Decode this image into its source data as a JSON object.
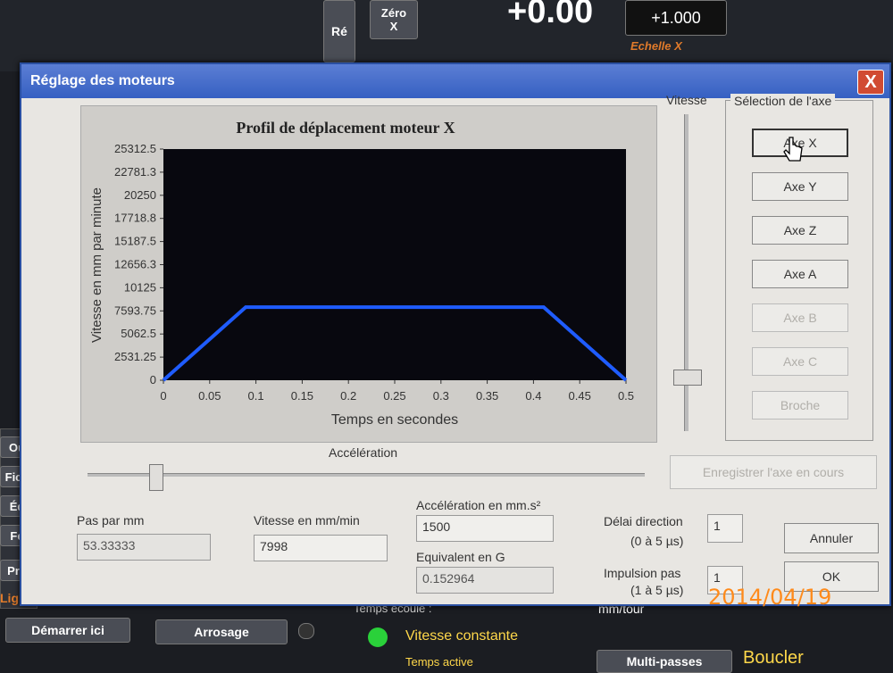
{
  "background": {
    "top_reset_label": "Ré",
    "zero_x_label": "Zéro\nX",
    "dro_value": "+0.00",
    "scale_value": "+1.000",
    "scale_label": "Echelle X",
    "left_menu": [
      "Ou",
      "Fich",
      "Éd",
      "Fe",
      "Pro"
    ],
    "ligne_label": "Ligne",
    "start_here_button": "Démarrer ici",
    "arrosage_button": "Arrosage",
    "vitesse_constante_label": "Vitesse constante",
    "multipasses_button": "Multi-passes",
    "boucler_button": "Boucler",
    "temps_ecoule_label": "Temps écoulé :",
    "mm_tour_label": "mm/tour",
    "temps_active_label": "Temps active"
  },
  "dialog": {
    "title": "Réglage des moteurs",
    "close_label": "X",
    "vitesse_label": "Vitesse",
    "axis_group_title": "Sélection de l'axe",
    "axis_buttons": [
      "Axe X",
      "Axe Y",
      "Axe Z",
      "Axe A",
      "Axe B",
      "Axe C",
      "Broche"
    ],
    "save_axis_button": "Enregistrer l'axe en cours",
    "acceleration_label": "Accélération",
    "pas_par_mm_label": "Pas par mm",
    "pas_par_mm_value": "53.33333",
    "vitesse_mm_min_label": "Vitesse en mm/min",
    "vitesse_mm_min_value": "7998",
    "accel_mm_s2_label": "Accélération en mm.s²",
    "accel_mm_s2_value": "1500",
    "equiv_g_label": "Equivalent en G",
    "equiv_g_value": "0.152964",
    "delai_direction_label": "Délai direction",
    "delai_direction_range": "(0 à 5 µs)",
    "delai_direction_value": "1",
    "impulsion_pas_label": "Impulsion pas",
    "impulsion_pas_range": "(1 à 5 µs)",
    "impulsion_pas_value": "1",
    "cancel_button": "Annuler",
    "ok_button": "OK"
  },
  "photo_date_stamp": "2014/04/19",
  "chart_data": {
    "type": "line",
    "title": "Profil de déplacement moteur X",
    "xlabel": "Temps en secondes",
    "ylabel": "Vitesse en mm par minute",
    "x_ticks": [
      "0",
      "0.05",
      "0.1",
      "0.15",
      "0.2",
      "0.25",
      "0.3",
      "0.35",
      "0.4",
      "0.45",
      "0.5"
    ],
    "y_ticks": [
      "0",
      "2531.25",
      "5062.5",
      "7593.75",
      "10125",
      "12656.3",
      "15187.5",
      "17718.8",
      "20250",
      "22781.3",
      "25312.5"
    ],
    "xlim": [
      0,
      0.5
    ],
    "ylim": [
      0,
      25312.5
    ],
    "series": [
      {
        "x": [
          0,
          0.089,
          0.411,
          0.5
        ],
        "y": [
          0,
          7998,
          7998,
          0
        ]
      }
    ],
    "colors": {
      "plot_bg": "#08080f",
      "line": "#1f5cff"
    }
  }
}
